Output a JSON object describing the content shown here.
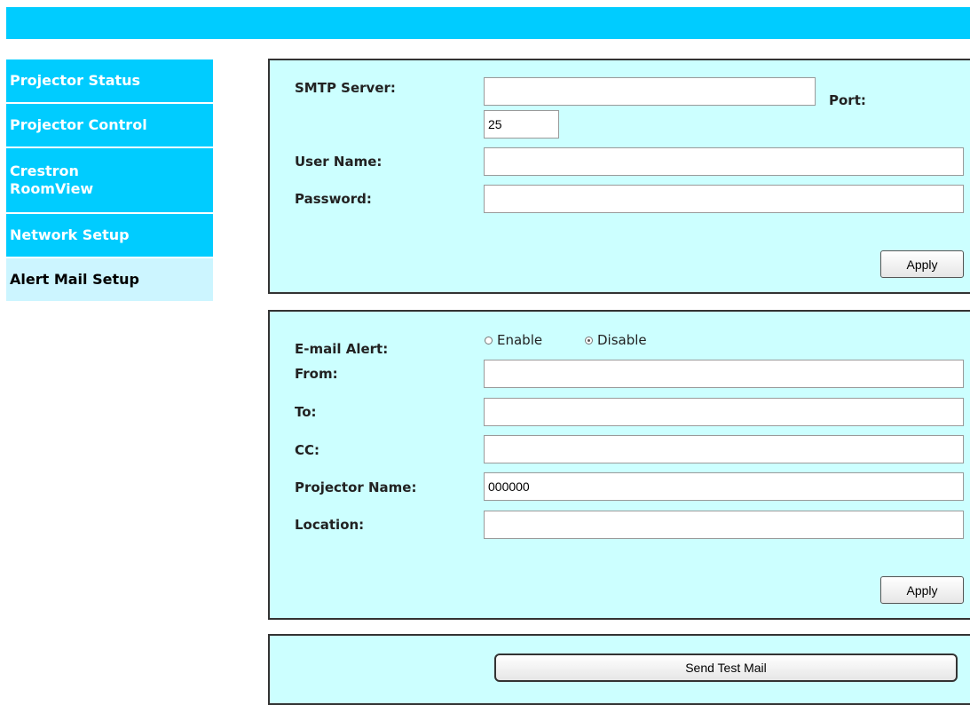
{
  "sidebar": {
    "items": [
      {
        "label": "Projector Status"
      },
      {
        "label": "Projector Control"
      },
      {
        "label": "Crestron RoomView"
      },
      {
        "label": "Network Setup"
      },
      {
        "label": "Alert Mail Setup"
      }
    ]
  },
  "smtp": {
    "server_label": "SMTP Server:",
    "server_value": "",
    "port_label": "Port:",
    "port_value": "25",
    "username_label": "User Name:",
    "username_value": "",
    "password_label": "Password:",
    "password_value": "",
    "apply_label": "Apply"
  },
  "alert": {
    "email_alert_label": "E-mail Alert:",
    "enable_label": "Enable",
    "disable_label": "Disable",
    "selected": "Disable",
    "from_label": "From:",
    "from_value": "",
    "to_label": "To:",
    "to_value": "",
    "cc_label": "CC:",
    "cc_value": "",
    "projector_name_label": "Projector Name:",
    "projector_name_value": "000000",
    "location_label": "Location:",
    "location_value": "",
    "apply_label": "Apply"
  },
  "test": {
    "send_label": "Send Test Mail"
  },
  "colors": {
    "nav_bg": "#00ccff",
    "nav_active_bg": "#ccf5ff",
    "panel_bg": "#ccffff",
    "panel_border": "#333333"
  }
}
